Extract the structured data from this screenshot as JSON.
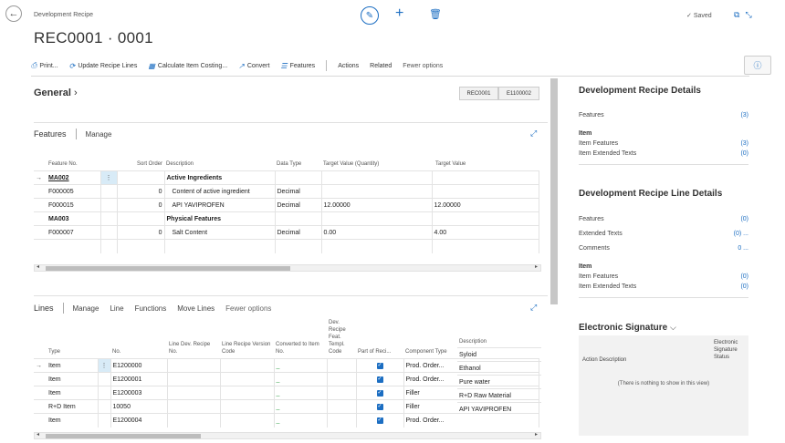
{
  "header": {
    "breadcrumb": "Development Recipe",
    "title": "REC0001 · 0001",
    "saved": "Saved"
  },
  "toolbar": {
    "print": "Print...",
    "update": "Update Recipe Lines",
    "calculate": "Calculate Item Costing...",
    "convert": "Convert",
    "features": "Features",
    "actions": "Actions",
    "related": "Related",
    "fewer": "Fewer options"
  },
  "general": {
    "title": "General",
    "chip1": "REC0001",
    "chip2": "E1100002"
  },
  "features_part": {
    "title": "Features",
    "manage": "Manage",
    "columns": [
      "Feature No.",
      "Sort Order",
      "Description",
      "Data Type",
      "Target Value (Quantity)",
      "Target Value"
    ],
    "rows": [
      {
        "no": "MA002",
        "sort": "",
        "desc": "Active Ingredients",
        "type": "",
        "qty": "",
        "val": ""
      },
      {
        "no": "F000005",
        "sort": "0",
        "desc": "Content of active ingredient",
        "type": "Decimal",
        "qty": "",
        "val": ""
      },
      {
        "no": "F000015",
        "sort": "0",
        "desc": "API YAVIPROFEN",
        "type": "Decimal",
        "qty": "12.00000",
        "val": "12.00000"
      },
      {
        "no": "MA003",
        "sort": "",
        "desc": "Physical Features",
        "type": "",
        "qty": "",
        "val": ""
      },
      {
        "no": "F000007",
        "sort": "0",
        "desc": "Salt Content",
        "type": "Decimal",
        "qty": "0.00",
        "val": "4.00"
      }
    ]
  },
  "lines_part": {
    "title": "Lines",
    "manage": "Manage",
    "line": "Line",
    "functions": "Functions",
    "move": "Move Lines",
    "fewer": "Fewer options",
    "columns": [
      "Type",
      "No.",
      "Line Dev. Recipe No.",
      "Line Recipe Version Code",
      "Converted to Item No.",
      "Dev. Recipe Feat. Templ. Code",
      "Part of Reci...",
      "Component Type",
      "Description"
    ],
    "rows": [
      {
        "type": "Item",
        "no": "E1200000",
        "comp": "Prod. Order...",
        "desc": "Syloid"
      },
      {
        "type": "Item",
        "no": "E1200001",
        "comp": "Prod. Order...",
        "desc": "Ethanol"
      },
      {
        "type": "Item",
        "no": "E1200003",
        "comp": "Filler",
        "desc": "Pure water"
      },
      {
        "type": "R+D Item",
        "no": "10050",
        "comp": "Filler",
        "desc": "R+D Raw Material"
      },
      {
        "type": "Item",
        "no": "E1200004",
        "comp": "Prod. Order...",
        "desc": "API YAVIPROFEN"
      }
    ]
  },
  "details": {
    "title": "Development Recipe Details",
    "features": "Features",
    "features_count": "(3)",
    "item_label": "Item",
    "item_features": "Item Features",
    "item_features_count": "(3)",
    "item_ext": "Item Extended Texts",
    "item_ext_count": "(0)"
  },
  "line_details": {
    "title": "Development Recipe Line Details",
    "features": "Features",
    "features_count": "(0)",
    "ext": "Extended Texts",
    "ext_count": "(0) ...",
    "comments": "Comments",
    "comments_count": "0 ...",
    "item_label": "Item",
    "item_features": "Item Features",
    "item_features_count": "(0)",
    "item_ext": "Item Extended Texts",
    "item_ext_count": "(0)"
  },
  "signature": {
    "title": "Electronic Signature",
    "col_action": "Action Description",
    "col_status": "Electronic Signature Status",
    "empty": "(There is nothing to show in this view)"
  },
  "colors": {
    "accent": "#1c6ec2",
    "selected_cell": "#d8ebf7"
  }
}
